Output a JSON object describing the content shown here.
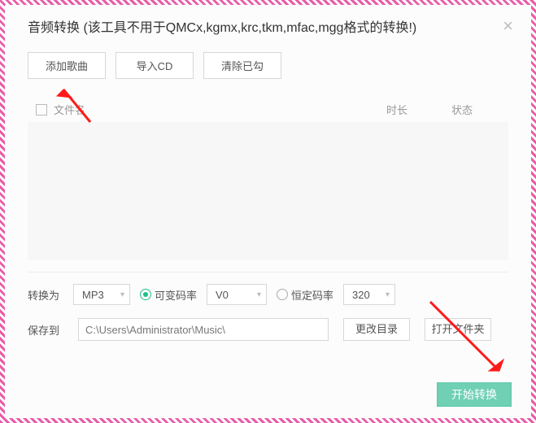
{
  "title": "音频转换 (该工具不用于QMCx,kgmx,krc,tkm,mfac,mgg格式的转换!)",
  "toolbar": {
    "add": "添加歌曲",
    "import_cd": "导入CD",
    "clear": "清除已勾"
  },
  "columns": {
    "filename": "文件名",
    "duration": "时长",
    "status": "状态"
  },
  "convert": {
    "label": "转换为",
    "format": "MP3",
    "vbr_label": "可变码率",
    "vbr_quality": "V0",
    "cbr_label": "恒定码率",
    "cbr_bitrate": "320",
    "mode": "vbr"
  },
  "save": {
    "label": "保存到",
    "path": "C:\\Users\\Administrator\\Music\\",
    "change_dir": "更改目录",
    "open_folder": "打开文件夹"
  },
  "action": {
    "start": "开始转换"
  }
}
